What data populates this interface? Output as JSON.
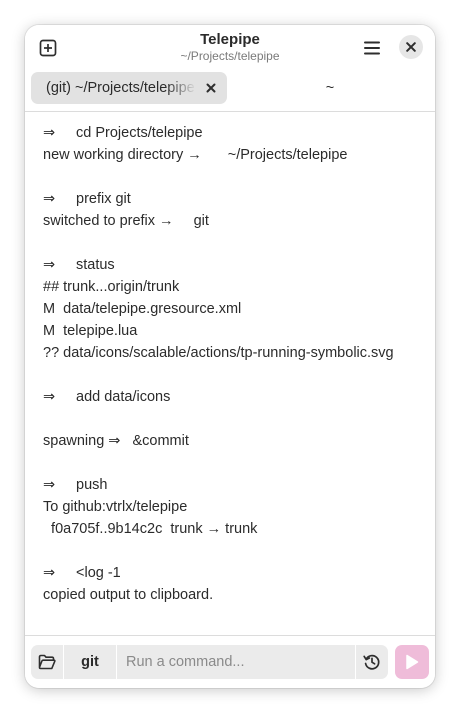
{
  "window": {
    "title": "Telepipe",
    "subtitle": "~/Projects/telepipe"
  },
  "tabs": [
    {
      "label": "(git) ~/Projects/telepipe",
      "active": true
    },
    {
      "label": "~",
      "active": false
    }
  ],
  "output": {
    "arrow": "⇒",
    "entries": [
      {
        "command": "cd Projects/telepipe"
      },
      {
        "prefix": "new working directory →",
        "value": "~/Projects/telepipe"
      },
      {
        "command": "prefix git"
      },
      {
        "prefix": "switched to prefix →",
        "value": "git"
      },
      {
        "command": "status"
      },
      {
        "text": "## trunk...origin/trunk"
      },
      {
        "text": "M  data/telepipe.gresource.xml"
      },
      {
        "text": "M  telepipe.lua"
      },
      {
        "text": "?? data/icons/scalable/actions/tp-running-symbolic.svg"
      },
      {
        "command": "add data/icons"
      },
      {
        "prefix": "spawning ⇒",
        "value": "&commit"
      },
      {
        "command": "push"
      },
      {
        "text": "To github:vtrlx/telepipe"
      },
      {
        "text": "  f0a705f..9b14c2c  trunk → trunk"
      },
      {
        "command": "<log -1"
      },
      {
        "text": "copied output to clipboard."
      }
    ]
  },
  "bottombar": {
    "prefix_label": "git",
    "placeholder": "Run a command..."
  },
  "icons": {
    "new_tab": "new-tab-icon",
    "menu": "hamburger-menu-icon",
    "close": "close-icon",
    "tab_close": "tab-close-icon",
    "folder": "folder-open-icon",
    "history": "history-icon",
    "run": "play-icon"
  },
  "colors": {
    "run_button": "#efbcd9",
    "run_icon": "#ffffff"
  }
}
